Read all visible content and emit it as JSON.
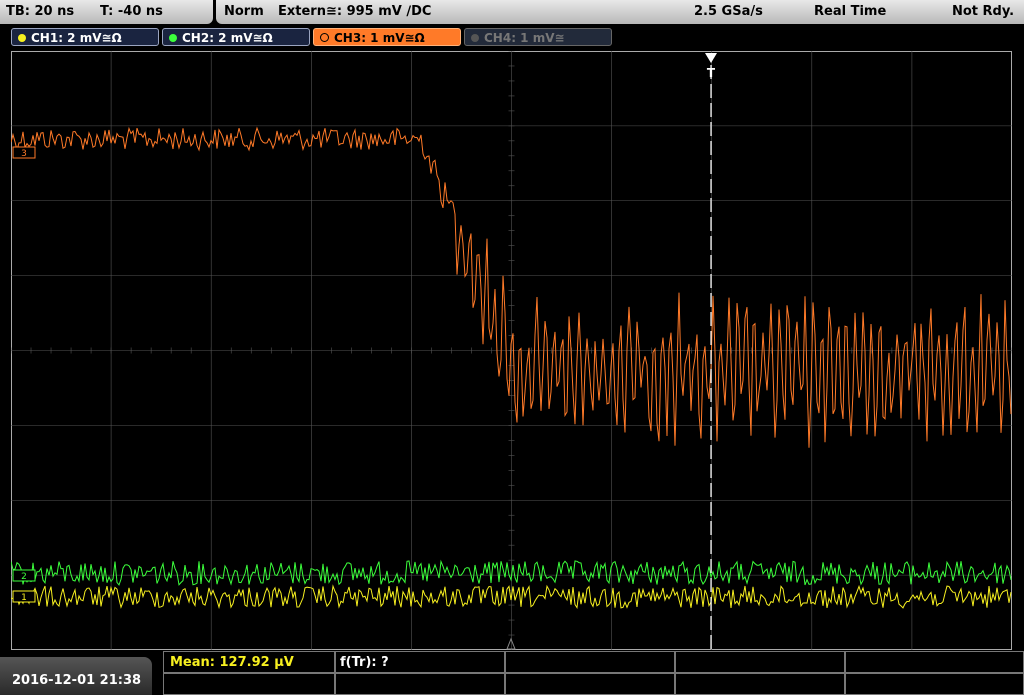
{
  "topbar": {
    "timebase": "TB: 20 ns",
    "trigger_time": "T: -40 ns",
    "mode": "Norm",
    "trigger_source": "Extern≅: 995 mV ∕DC",
    "sample_rate": "2.5 GSa/s",
    "acq_mode": "Real Time",
    "status": "Not Rdy."
  },
  "channels": [
    {
      "label": "CH1: 2 mV≅Ω",
      "color": "#f7f020",
      "state": "on"
    },
    {
      "label": "CH2: 2 mV≅Ω",
      "color": "#3cff3c",
      "state": "on"
    },
    {
      "label": "CH3: 1 mV≅Ω",
      "color": "#ff7a28",
      "state": "selected"
    },
    {
      "label": "CH4: 1 mV≅",
      "color": "#777777",
      "state": "off"
    }
  ],
  "markers": {
    "ch3": "3",
    "ch2": "2",
    "ch1": "1",
    "trigger": "T"
  },
  "measurement": {
    "mean": "Mean: 127.92 µV",
    "f_tr": "f(Tr): ?"
  },
  "datetime": "2016-12-01 21:38",
  "colors": {
    "ch1": "#f7f020",
    "ch2": "#3cff3c",
    "ch3": "#ff7a28",
    "grid": "#555555",
    "trigger_line": "#ffffff"
  }
}
